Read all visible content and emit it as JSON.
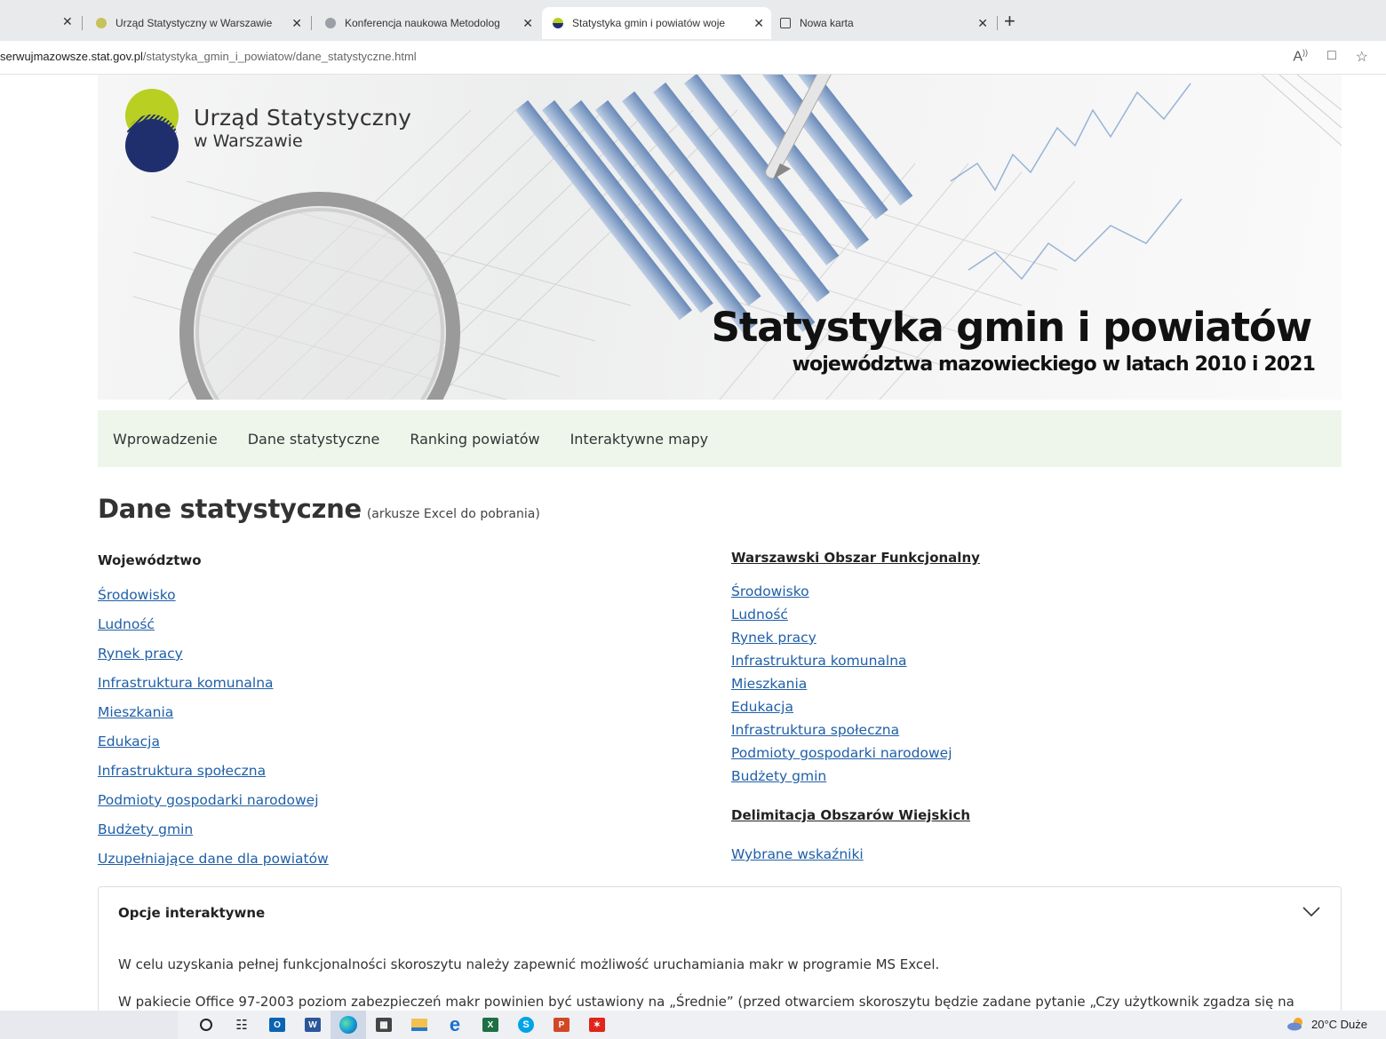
{
  "browser": {
    "tabs": [
      {
        "title": "Urząd Statystyczny w Warszawie",
        "active": false
      },
      {
        "title": "Konferencja naukowa Metodolog",
        "active": false
      },
      {
        "title": "Statystyka gmin i powiatów woje",
        "active": true
      },
      {
        "title": "Nowa karta",
        "active": false
      }
    ],
    "new_tab_glyph": "+",
    "close_glyph": "✕",
    "url_prefix": "serwujmazowsze.stat.gov.pl",
    "url_path": "/statystyka_gmin_i_powiatow/dane_statystyczne.html",
    "icons": [
      "read-aloud-icon",
      "immersive-reader-icon",
      "favorite-star-icon"
    ]
  },
  "banner": {
    "logo_line1": "Urząd Statystyczny",
    "logo_line2": "w Warszawie",
    "title": "Statystyka gmin i powiatów",
    "subtitle": "województwa mazowieckiego w latach 2010 i 2021"
  },
  "nav": {
    "items": [
      "Wprowadzenie",
      "Dane statystyczne",
      "Ranking powiatów",
      "Interaktywne mapy"
    ]
  },
  "page": {
    "title": "Dane statystyczne",
    "title_note": "(arkusze Excel do pobrania)"
  },
  "left": {
    "heading": "Województwo",
    "links": [
      "Środowisko",
      "Ludność",
      "Rynek pracy",
      "Infrastruktura komunalna",
      "Mieszkania",
      "Edukacja",
      "Infrastruktura społeczna",
      "Podmioty gospodarki narodowej",
      "Budżety gmin",
      "Uzupełniające dane dla powiatów"
    ]
  },
  "right": {
    "heading": "Warszawski Obszar Funkcjonalny",
    "links": [
      "Środowisko",
      "Ludność",
      "Rynek pracy",
      "Infrastruktura komunalna",
      "Mieszkania",
      "Edukacja",
      "Infrastruktura społeczna",
      "Podmioty gospodarki narodowej",
      "Budżety gmin"
    ],
    "heading2": "Delimitacja Obszarów Wiejskich",
    "links2": [
      "Wybrane wskaźniki"
    ]
  },
  "accordion": {
    "heading": "Opcje interaktywne",
    "p1": "W celu uzyskania pełnej funkcjonalności skoroszytu należy zapewnić możliwość uruchamiania makr w programie MS Excel.",
    "p2": "W pakiecie Office 97-2003 poziom zabezpieczeń makr powinien być ustawiony na „Średnie” (przed otwarciem skoroszytu będzie zadane pytanie „Czy użytkownik zgadza się na"
  },
  "taskbar": {
    "icons": [
      "cortana-icon",
      "task-view-icon",
      "outlook-icon",
      "word-icon",
      "edge-icon",
      "calculator-icon",
      "file-explorer-icon",
      "internet-explorer-icon",
      "excel-icon",
      "skype-icon",
      "powerpoint-icon",
      "acrobat-icon"
    ],
    "weather": "20°C Duże"
  },
  "colors": {
    "link": "#1f5fa8",
    "nav_bg": "#eef6ec",
    "logo_green": "#b9cf22",
    "logo_navy": "#1f2f6e"
  }
}
